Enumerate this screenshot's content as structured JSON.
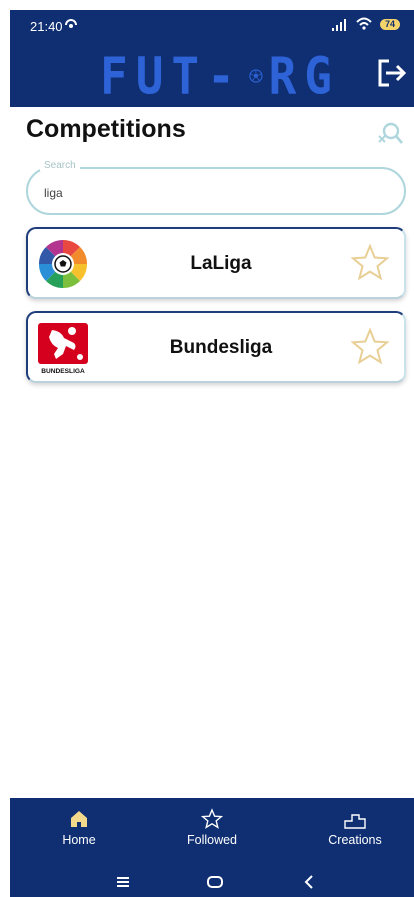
{
  "status_bar": {
    "time": "21:40",
    "battery": "74"
  },
  "header": {
    "logo_left": "FUT-",
    "logo_right": "RG"
  },
  "page": {
    "title": "Competitions"
  },
  "search": {
    "legend": "Search",
    "value": "liga"
  },
  "competitions": [
    {
      "name": "LaLiga"
    },
    {
      "name": "Bundesliga",
      "logo_text": "BUNDESLIGA"
    }
  ],
  "bottom_nav": {
    "home": "Home",
    "followed": "Followed",
    "creations": "Creations"
  },
  "colors": {
    "primary": "#0f2f72",
    "logo": "#2d63d6",
    "star": "#e8cf96",
    "accent": "#aed6dc",
    "home_icon": "#f3d98b"
  }
}
